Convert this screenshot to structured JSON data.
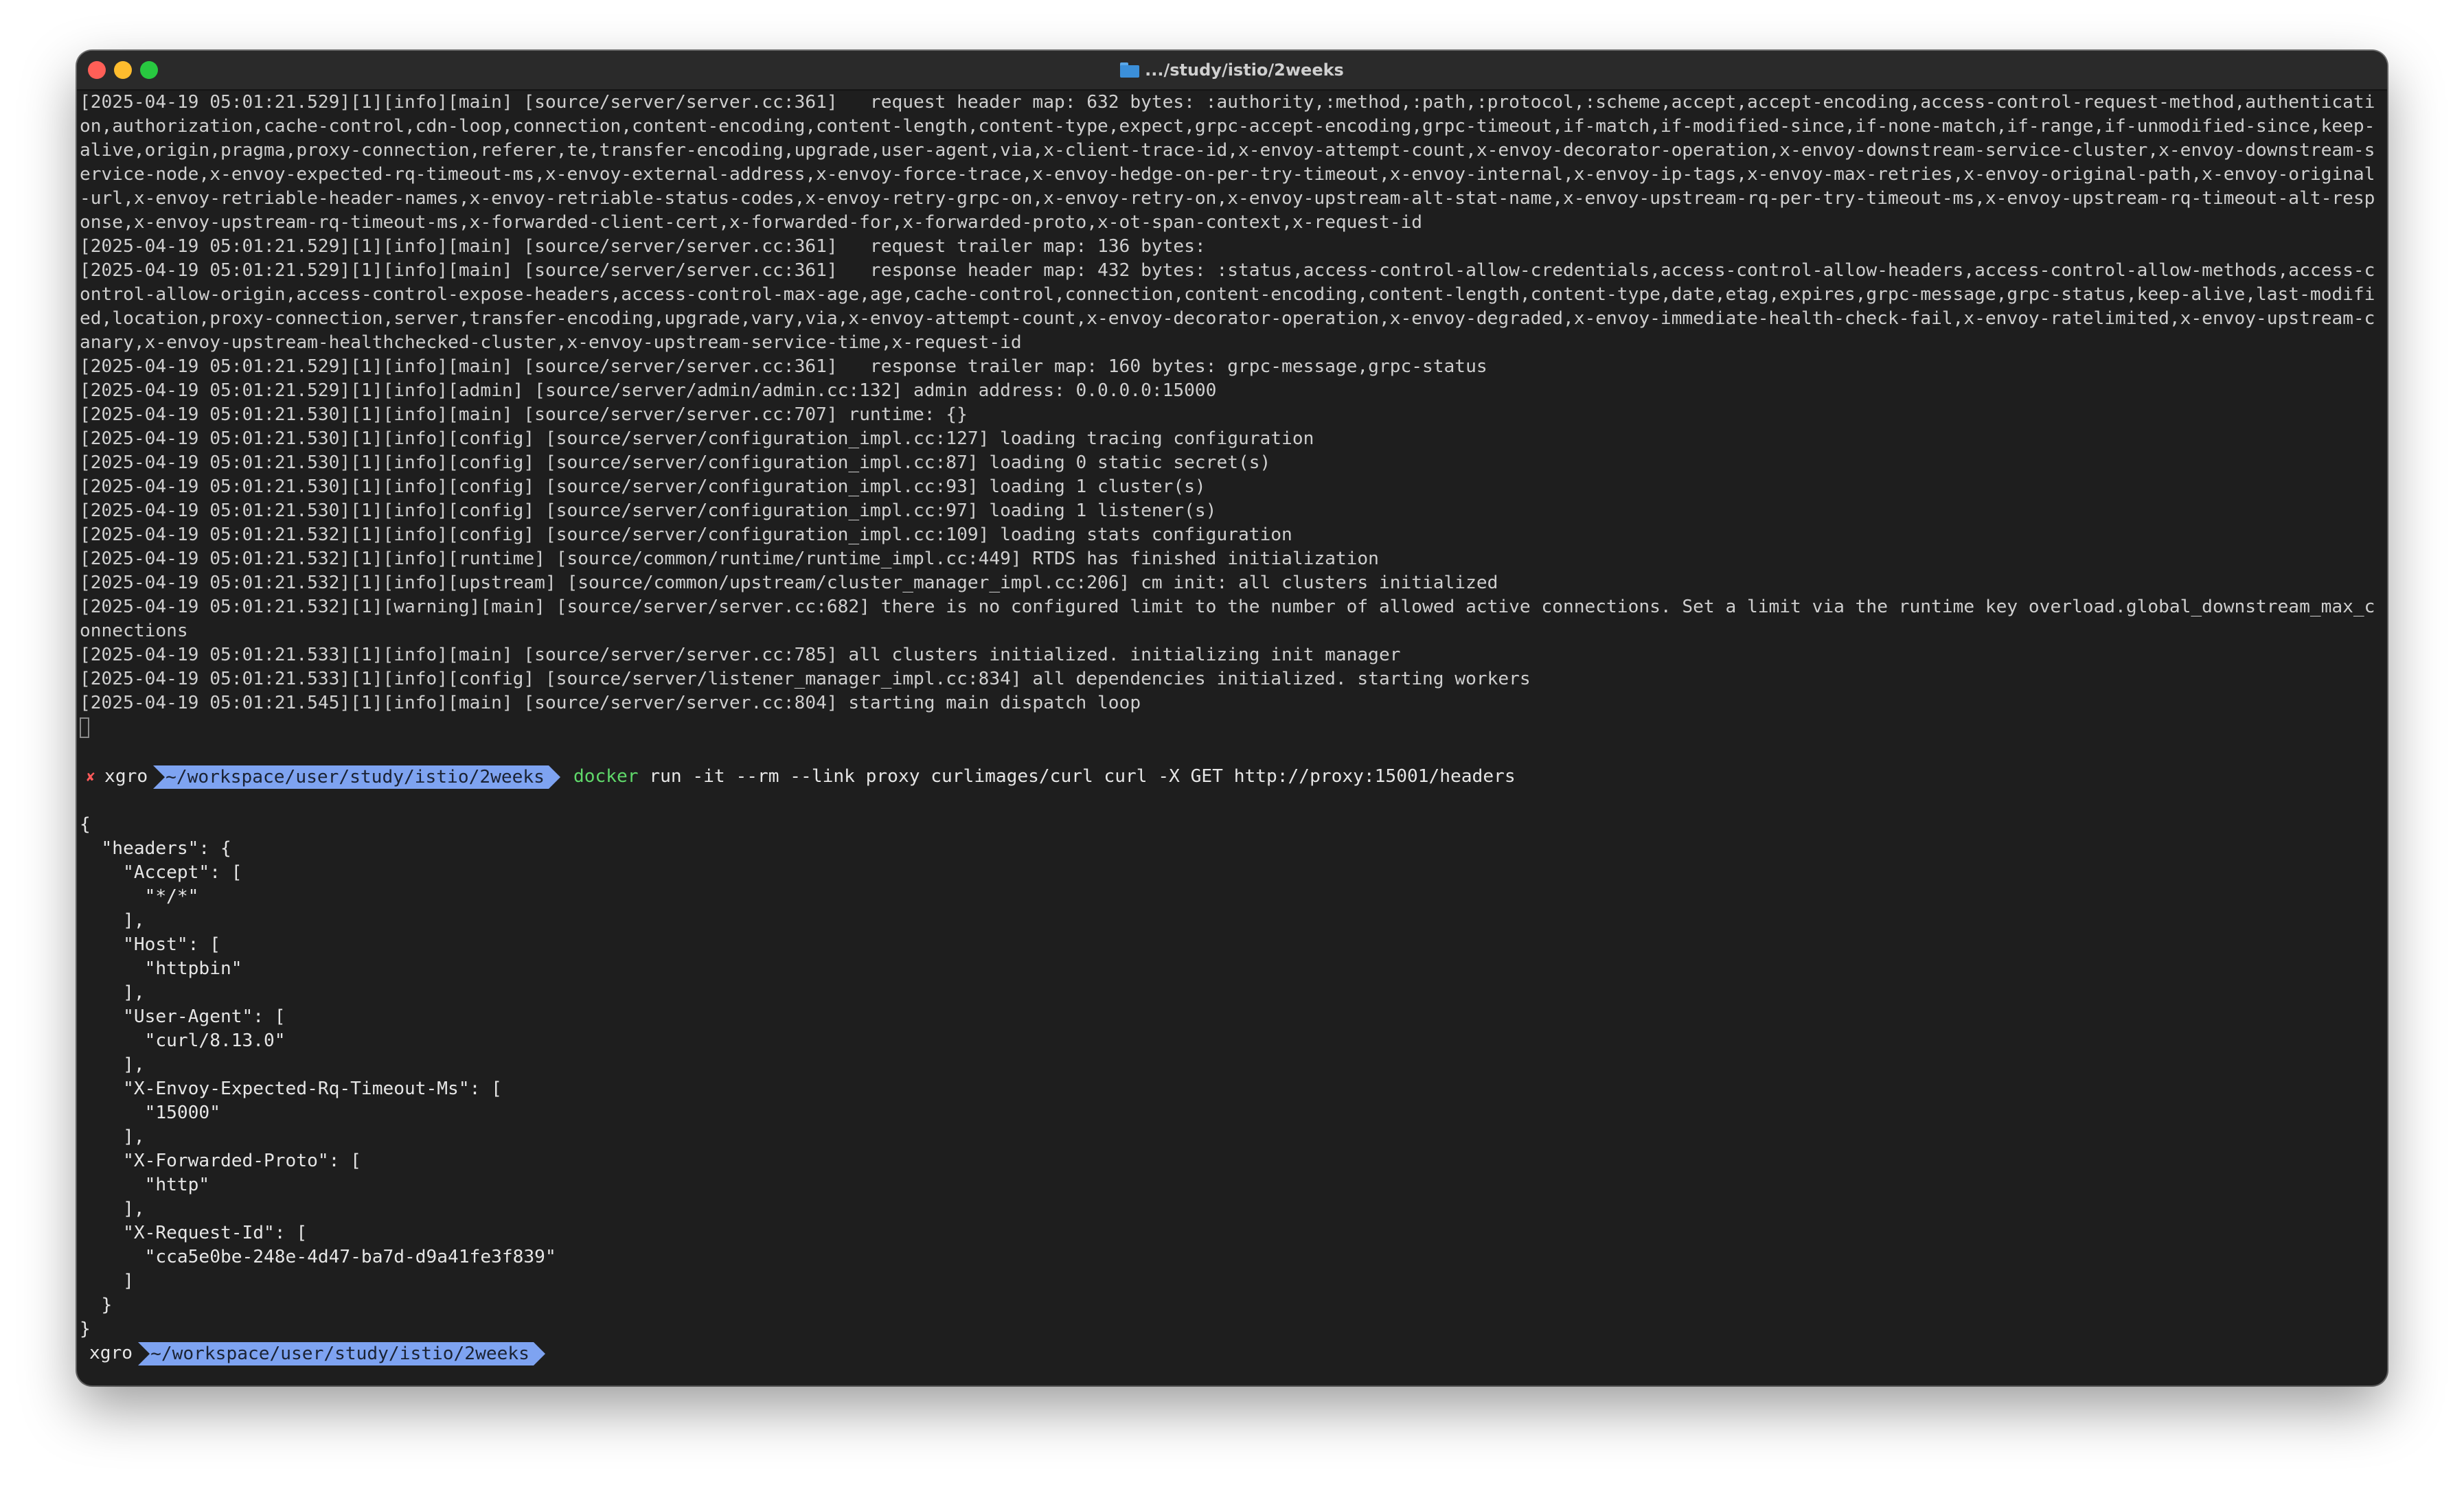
{
  "window": {
    "title": ".../study/istio/2weeks",
    "title_icon": "folder-icon"
  },
  "colors": {
    "background": "#1e1e1e",
    "text": "#cfcfcf",
    "prompt_path_bg": "#7ea3f1",
    "command_green": "#5fd86a",
    "error_red": "#ff5a5a"
  },
  "log_lines": [
    "[2025-04-19 05:01:21.529][1][info][main] [source/server/server.cc:361]   request header map: 632 bytes: :authority,:method,:path,:protocol,:scheme,accept,accept-encoding,access-control-request-method,authentication,authorization,cache-control,cdn-loop,connection,content-encoding,content-length,content-type,expect,grpc-accept-encoding,grpc-timeout,if-match,if-modified-since,if-none-match,if-range,if-unmodified-since,keep-alive,origin,pragma,proxy-connection,referer,te,transfer-encoding,upgrade,user-agent,via,x-client-trace-id,x-envoy-attempt-count,x-envoy-decorator-operation,x-envoy-downstream-service-cluster,x-envoy-downstream-service-node,x-envoy-expected-rq-timeout-ms,x-envoy-external-address,x-envoy-force-trace,x-envoy-hedge-on-per-try-timeout,x-envoy-internal,x-envoy-ip-tags,x-envoy-max-retries,x-envoy-original-path,x-envoy-original-url,x-envoy-retriable-header-names,x-envoy-retriable-status-codes,x-envoy-retry-grpc-on,x-envoy-retry-on,x-envoy-upstream-alt-stat-name,x-envoy-upstream-rq-per-try-timeout-ms,x-envoy-upstream-rq-timeout-alt-response,x-envoy-upstream-rq-timeout-ms,x-forwarded-client-cert,x-forwarded-for,x-forwarded-proto,x-ot-span-context,x-request-id",
    "[2025-04-19 05:01:21.529][1][info][main] [source/server/server.cc:361]   request trailer map: 136 bytes:",
    "[2025-04-19 05:01:21.529][1][info][main] [source/server/server.cc:361]   response header map: 432 bytes: :status,access-control-allow-credentials,access-control-allow-headers,access-control-allow-methods,access-control-allow-origin,access-control-expose-headers,access-control-max-age,age,cache-control,connection,content-encoding,content-length,content-type,date,etag,expires,grpc-message,grpc-status,keep-alive,last-modified,location,proxy-connection,server,transfer-encoding,upgrade,vary,via,x-envoy-attempt-count,x-envoy-decorator-operation,x-envoy-degraded,x-envoy-immediate-health-check-fail,x-envoy-ratelimited,x-envoy-upstream-canary,x-envoy-upstream-healthchecked-cluster,x-envoy-upstream-service-time,x-request-id",
    "[2025-04-19 05:01:21.529][1][info][main] [source/server/server.cc:361]   response trailer map: 160 bytes: grpc-message,grpc-status",
    "[2025-04-19 05:01:21.529][1][info][admin] [source/server/admin/admin.cc:132] admin address: 0.0.0.0:15000",
    "[2025-04-19 05:01:21.530][1][info][main] [source/server/server.cc:707] runtime: {}",
    "[2025-04-19 05:01:21.530][1][info][config] [source/server/configuration_impl.cc:127] loading tracing configuration",
    "[2025-04-19 05:01:21.530][1][info][config] [source/server/configuration_impl.cc:87] loading 0 static secret(s)",
    "[2025-04-19 05:01:21.530][1][info][config] [source/server/configuration_impl.cc:93] loading 1 cluster(s)",
    "[2025-04-19 05:01:21.530][1][info][config] [source/server/configuration_impl.cc:97] loading 1 listener(s)",
    "[2025-04-19 05:01:21.532][1][info][config] [source/server/configuration_impl.cc:109] loading stats configuration",
    "[2025-04-19 05:01:21.532][1][info][runtime] [source/common/runtime/runtime_impl.cc:449] RTDS has finished initialization",
    "[2025-04-19 05:01:21.532][1][info][upstream] [source/common/upstream/cluster_manager_impl.cc:206] cm init: all clusters initialized",
    "[2025-04-19 05:01:21.532][1][warning][main] [source/server/server.cc:682] there is no configured limit to the number of allowed active connections. Set a limit via the runtime key overload.global_downstream_max_connections",
    "[2025-04-19 05:01:21.533][1][info][main] [source/server/server.cc:785] all clusters initialized. initializing init manager",
    "[2025-04-19 05:01:21.533][1][info][config] [source/server/listener_manager_impl.cc:834] all dependencies initialized. starting workers",
    "[2025-04-19 05:01:21.545][1][info][main] [source/server/server.cc:804] starting main dispatch loop"
  ],
  "prompt1": {
    "status": "✘",
    "user": "xgro",
    "path": "~/workspace/user/study/istio/2weeks",
    "command_name": "docker",
    "command_args": " run -it --rm --link proxy curlimages/curl curl -X GET http://proxy:15001/headers"
  },
  "output_lines": [
    "{",
    "  \"headers\": {",
    "    \"Accept\": [",
    "      \"*/*\"",
    "    ],",
    "    \"Host\": [",
    "      \"httpbin\"",
    "    ],",
    "    \"User-Agent\": [",
    "      \"curl/8.13.0\"",
    "    ],",
    "    \"X-Envoy-Expected-Rq-Timeout-Ms\": [",
    "      \"15000\"",
    "    ],",
    "    \"X-Forwarded-Proto\": [",
    "      \"http\"",
    "    ],",
    "    \"X-Request-Id\": [",
    "      \"cca5e0be-248e-4d47-ba7d-d9a41fe3f839\"",
    "    ]",
    "  }",
    "}"
  ],
  "prompt2": {
    "user": "xgro",
    "path": "~/workspace/user/study/istio/2weeks"
  }
}
